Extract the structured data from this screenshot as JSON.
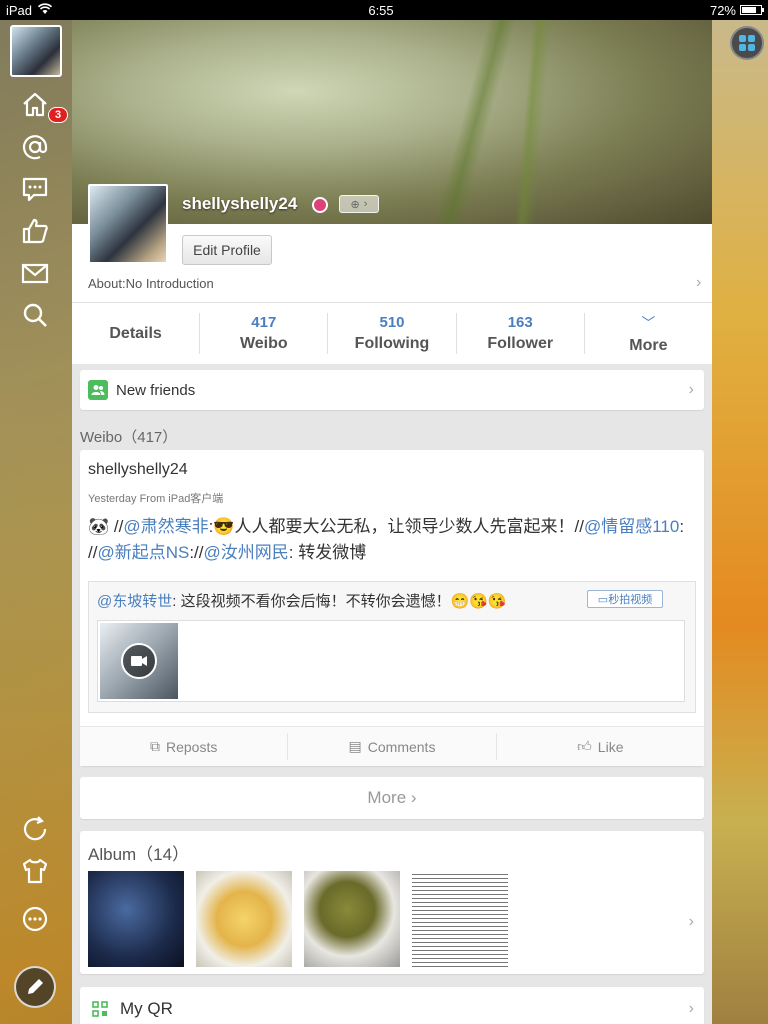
{
  "status": {
    "device": "iPad",
    "time": "6:55",
    "battery": "72%"
  },
  "sidebar": {
    "notification_count": "3"
  },
  "profile": {
    "username": "shellyshelly24",
    "edit_label": "Edit Profile",
    "about": "About:No Introduction"
  },
  "stats": {
    "details": "Details",
    "weibo_count": "417",
    "weibo_label": "Weibo",
    "following_count": "510",
    "following_label": "Following",
    "follower_count": "163",
    "follower_label": "Follower",
    "more_label": "More"
  },
  "new_friends": "New friends",
  "weibo_section": "Weibo（417）",
  "post": {
    "user": "shellyshelly24",
    "meta": "Yesterday  From iPad客户端",
    "t1": "//",
    "m1": "@肃然寒非",
    "t2": ":😎人人都要大公无私，让领导少数人先富起来！//",
    "m2": "@情留感110",
    "t3": ": //",
    "m3": "@新起点NS",
    "t4": "://",
    "m4": "@汝州网民",
    "t5": ": 转发微博",
    "repost_mention": "@东坡转世",
    "repost_text": ": 这段视频不看你会后悔！不转你会遗憾！😁😘😘",
    "video_tag": "秒拍视频",
    "reposts": "Reposts",
    "comments": "Comments",
    "like": "Like"
  },
  "more_button": "More",
  "album": {
    "title": "Album（14）"
  },
  "qr": "My QR"
}
